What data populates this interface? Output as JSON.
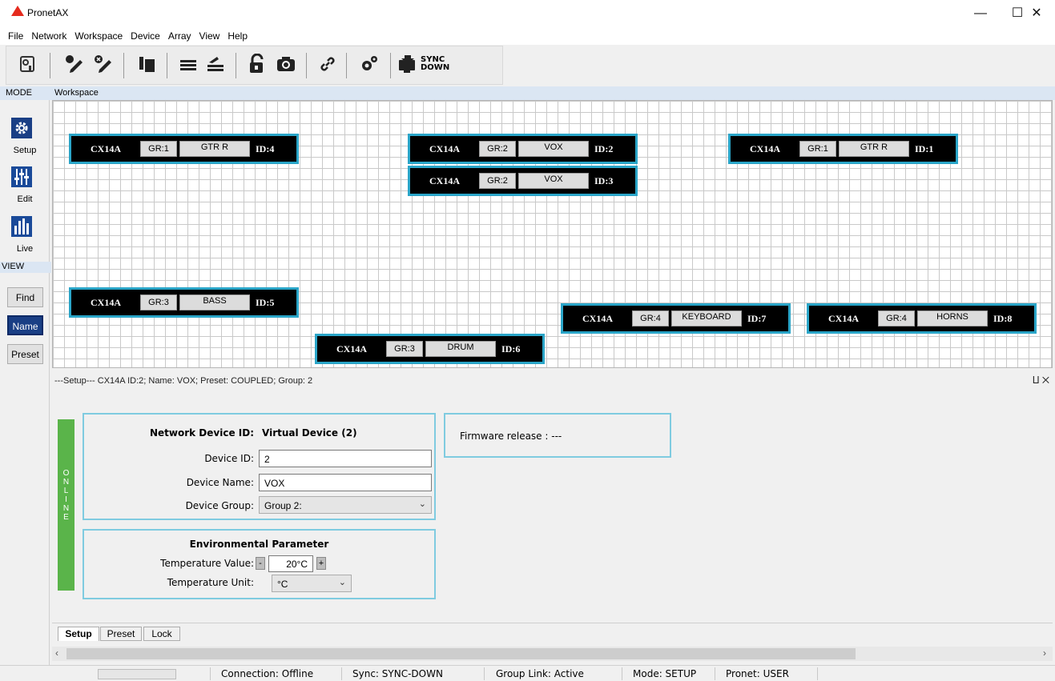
{
  "app": {
    "title": "PronetAX",
    "brand_color": "#e52b1e"
  },
  "menu": [
    "File",
    "Network",
    "Workspace",
    "Device",
    "Array",
    "View",
    "Help"
  ],
  "toolbar": {
    "icons": [
      "device-settings-icon",
      "pencil-icon",
      "pencil-disabled-icon",
      "copy-icon",
      "align-icon",
      "stack-icon",
      "unlock-icon",
      "camera-icon",
      "link-icon",
      "gears-icon",
      "sync-down-icon"
    ],
    "sync_label_top": "SYNC",
    "sync_label_bottom": "DOWN"
  },
  "header": {
    "mode": "MODE",
    "workspace": "Workspace"
  },
  "left_panel": {
    "modes": [
      "Setup",
      "Edit",
      "Live"
    ],
    "view_header": "VIEW",
    "views": [
      "Find",
      "Name",
      "Preset"
    ],
    "selected_view": "Name"
  },
  "devices": [
    {
      "model": "CX14A",
      "group": "GR:1",
      "name": "GTR R",
      "id": "ID:4"
    },
    {
      "model": "CX14A",
      "group": "GR:2",
      "name": "VOX",
      "id": "ID:2"
    },
    {
      "model": "CX14A",
      "group": "GR:2",
      "name": "VOX",
      "id": "ID:3"
    },
    {
      "model": "CX14A",
      "group": "GR:1",
      "name": "GTR R",
      "id": "ID:1"
    },
    {
      "model": "CX14A",
      "group": "GR:3",
      "name": "BASS",
      "id": "ID:5"
    },
    {
      "model": "CX14A",
      "group": "GR:4",
      "name": "KEYBOARD",
      "id": "ID:7"
    },
    {
      "model": "CX14A",
      "group": "GR:4",
      "name": "HORNS",
      "id": "ID:8"
    },
    {
      "model": "CX14A",
      "group": "GR:3",
      "name": "DRUM",
      "id": "ID:6"
    }
  ],
  "setup": {
    "header": "---Setup--- CX14A ID:2; Name: VOX; Preset: COUPLED; Group: 2",
    "pin": "⨿ ✕",
    "online_letters": [
      "O",
      "N",
      "L",
      "I",
      "N",
      "E"
    ],
    "online_color": "#5ab44a",
    "net_id_label": "Network Device ID:",
    "net_id_value": "Virtual Device (2)",
    "device_id_label": "Device ID:",
    "device_id_value": "2",
    "device_name_label": "Device Name:",
    "device_name_value": "VOX",
    "device_group_label": "Device Group:",
    "device_group_value": "Group 2:",
    "env_title": "Environmental Parameter",
    "temp_value_label": "Temperature Value:",
    "temp_minus": "-",
    "temp_value": "20°C",
    "temp_plus": "+",
    "temp_unit_label": "Temperature Unit:",
    "temp_unit_value": "°C",
    "firmware": "Firmware release  : ---"
  },
  "tabs": [
    "Setup",
    "Preset",
    "Lock"
  ],
  "active_tab": "Setup",
  "status": {
    "connection": "Connection: Offline",
    "sync": "Sync: SYNC-DOWN",
    "group_link": "Group Link: Active",
    "mode": "Mode: SETUP",
    "pronet": "Pronet: USER"
  }
}
